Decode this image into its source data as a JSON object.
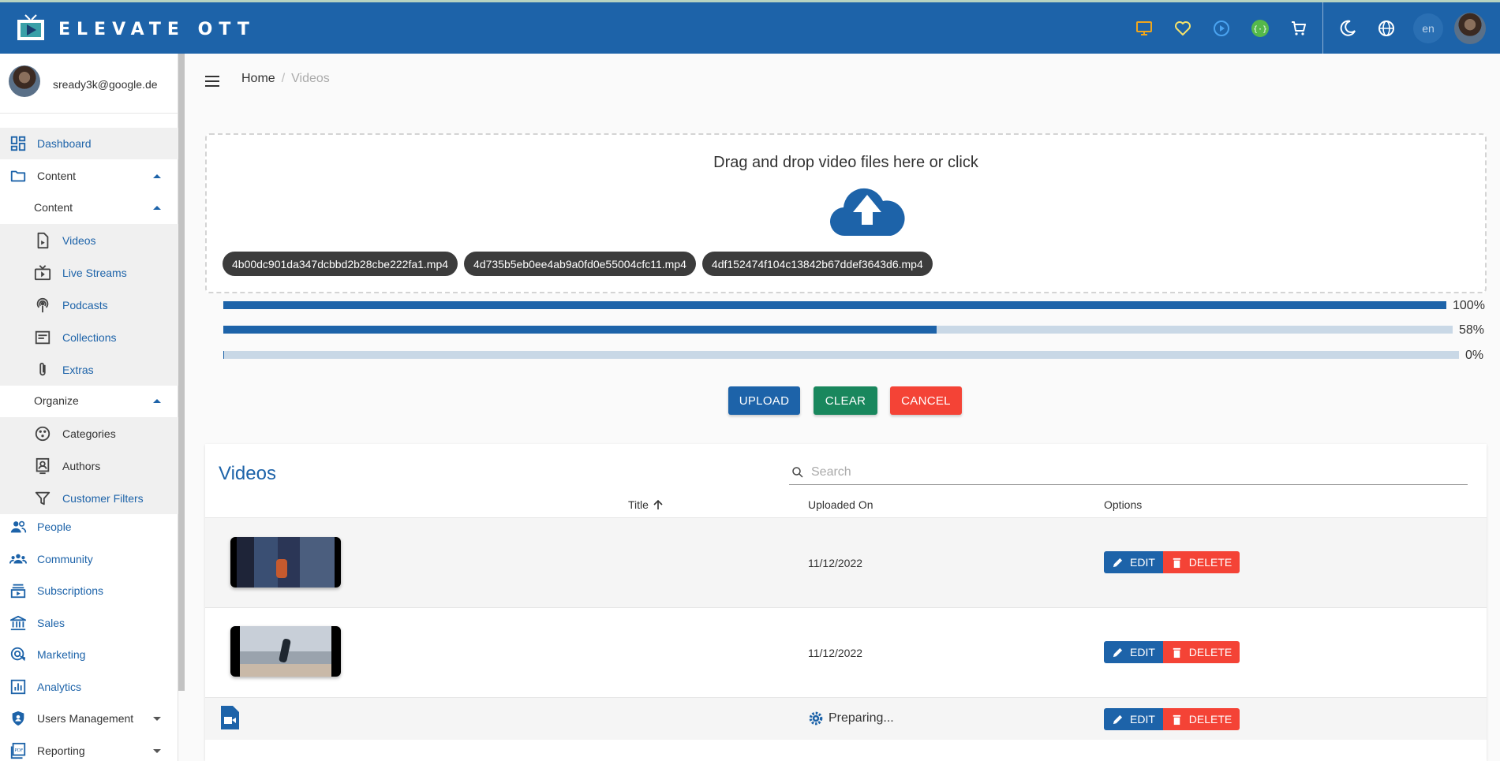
{
  "header": {
    "brand": "ELEVATE OTT",
    "language": "en",
    "colors": {
      "bar": "#1d63a9",
      "monitor_icon": "#f0a61c",
      "heart_icon": "#f5e26b",
      "play_icon": "#4aa3f0",
      "api_icon": "#55b94b"
    }
  },
  "sidebar": {
    "user_email": "sready3k@google.de",
    "items": [
      {
        "label": "Dashboard",
        "icon": "dashboard-icon"
      },
      {
        "label": "Content",
        "icon": "folder-icon"
      },
      {
        "label": "Content"
      },
      {
        "label": "Videos",
        "icon": "video-file-icon"
      },
      {
        "label": "Live Streams",
        "icon": "live-tv-icon"
      },
      {
        "label": "Podcasts",
        "icon": "podcast-icon"
      },
      {
        "label": "Collections",
        "icon": "collections-icon"
      },
      {
        "label": "Extras",
        "icon": "paperclip-icon"
      },
      {
        "label": "Organize"
      },
      {
        "label": "Categories",
        "icon": "categories-icon"
      },
      {
        "label": "Authors",
        "icon": "author-icon"
      },
      {
        "label": "Customer Filters",
        "icon": "filter-icon"
      },
      {
        "label": "People",
        "icon": "people-icon"
      },
      {
        "label": "Community",
        "icon": "community-icon"
      },
      {
        "label": "Subscriptions",
        "icon": "subscriptions-icon"
      },
      {
        "label": "Sales",
        "icon": "bank-icon"
      },
      {
        "label": "Marketing",
        "icon": "marketing-icon"
      },
      {
        "label": "Analytics",
        "icon": "analytics-icon"
      },
      {
        "label": "Users Management",
        "icon": "shield-icon"
      },
      {
        "label": "Reporting",
        "icon": "report-icon"
      }
    ]
  },
  "breadcrumb": {
    "home": "Home",
    "separator": "/",
    "current": "Videos"
  },
  "upload": {
    "dropzone_text": "Drag and drop video files here or click",
    "files": [
      "4b00dc901da347dcbbd2b28cbe222fa1.mp4",
      "4d735b5eb0ee4ab9a0fd0e55004cfc11.mp4",
      "4df152474f104c13842b67ddef3643d6.mp4"
    ],
    "progress": [
      {
        "percent": 100,
        "label": "100%"
      },
      {
        "percent": 58,
        "label": "58%"
      },
      {
        "percent": 0,
        "label": "0%"
      }
    ],
    "buttons": {
      "upload": "UPLOAD",
      "clear": "CLEAR",
      "cancel": "CANCEL"
    }
  },
  "videos": {
    "title": "Videos",
    "search_placeholder": "Search",
    "columns": {
      "title": "Title",
      "uploaded_on": "Uploaded On",
      "options": "Options"
    },
    "rows": [
      {
        "uploaded_on": "11/12/2022",
        "edit": "EDIT",
        "delete": "DELETE"
      },
      {
        "uploaded_on": "11/12/2022",
        "edit": "EDIT",
        "delete": "DELETE"
      },
      {
        "status": "Preparing...",
        "edit": "EDIT",
        "delete": "DELETE"
      }
    ]
  }
}
